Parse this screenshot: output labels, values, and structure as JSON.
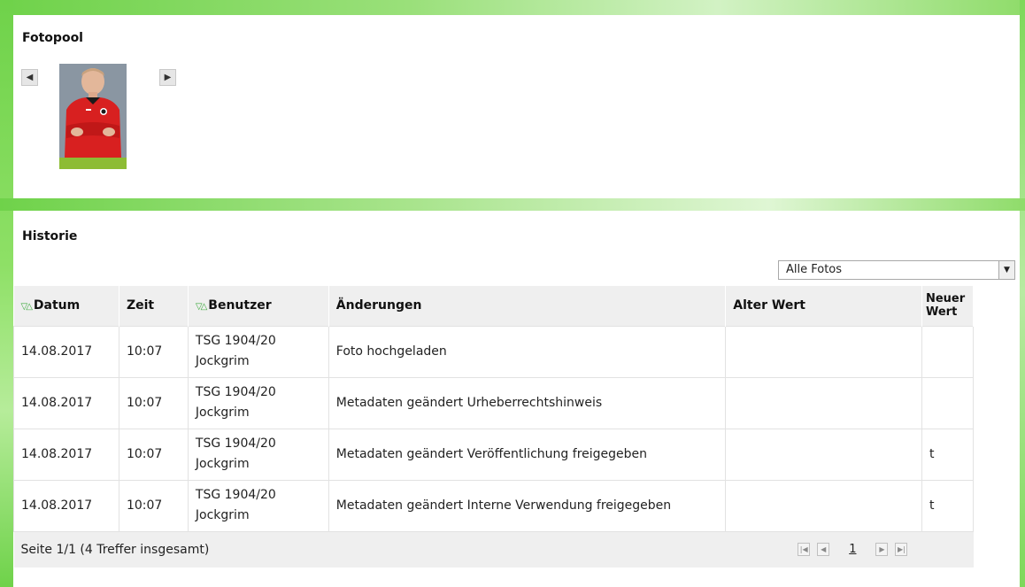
{
  "fotopool": {
    "title": "Fotopool",
    "prev_icon": "triangle-left-icon",
    "next_icon": "triangle-right-icon"
  },
  "historie": {
    "title": "Historie",
    "filter": {
      "selected": "Alle Fotos"
    },
    "columns": {
      "datum": "Datum",
      "zeit": "Zeit",
      "benutzer": "Benutzer",
      "aenderungen": "Änderungen",
      "alter_wert": "Alter Wert",
      "neuer_wert_1": "Neuer",
      "neuer_wert_2": "Wert"
    },
    "rows": [
      {
        "datum": "14.08.2017",
        "zeit": "10:07",
        "benutzer_1": "TSG 1904/20",
        "benutzer_2": "Jockgrim",
        "aenderung": "Foto hochgeladen",
        "alter_wert": "",
        "neuer_wert": ""
      },
      {
        "datum": "14.08.2017",
        "zeit": "10:07",
        "benutzer_1": "TSG 1904/20",
        "benutzer_2": "Jockgrim",
        "aenderung": "Metadaten geändert Urheberrechtshinweis",
        "alter_wert": "",
        "neuer_wert": ""
      },
      {
        "datum": "14.08.2017",
        "zeit": "10:07",
        "benutzer_1": "TSG 1904/20",
        "benutzer_2": "Jockgrim",
        "aenderung": "Metadaten geändert Veröffentlichung freigegeben",
        "alter_wert": "",
        "neuer_wert": "t"
      },
      {
        "datum": "14.08.2017",
        "zeit": "10:07",
        "benutzer_1": "TSG 1904/20",
        "benutzer_2": "Jockgrim",
        "aenderung": "Metadaten geändert Interne Verwendung freigegeben",
        "alter_wert": "",
        "neuer_wert": "t"
      }
    ],
    "footer": {
      "summary": "Seite 1/1 (4 Treffer insgesamt)",
      "current_page": "1"
    }
  },
  "colors": {
    "frame_green": "#6fd24a",
    "photo_bar_green": "#8dbc34",
    "sort_icon_green": "#39a83a",
    "header_bg": "#efefef"
  }
}
